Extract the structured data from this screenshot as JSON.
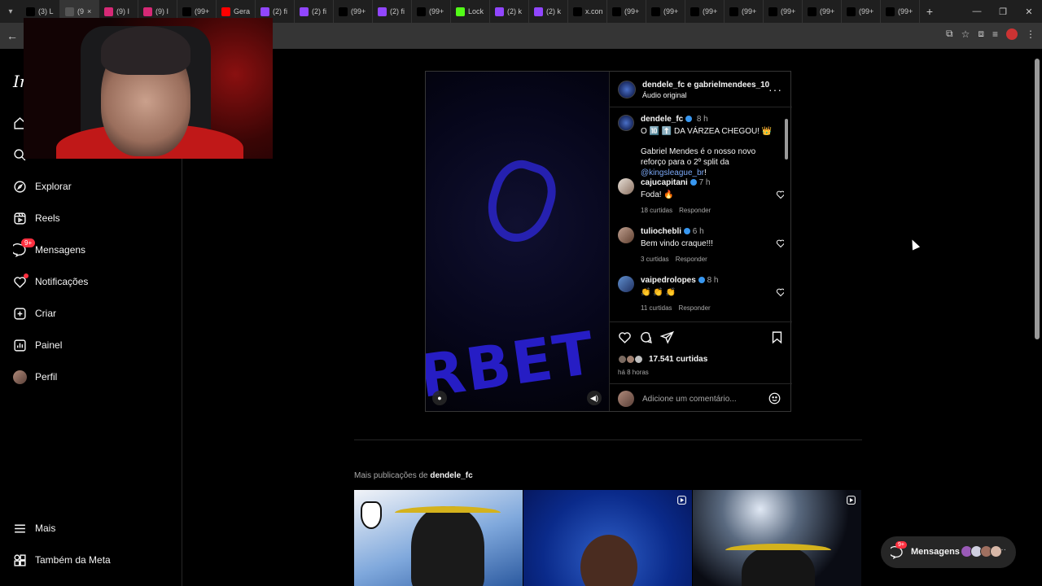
{
  "browser": {
    "tabs": [
      {
        "label": "(3) L",
        "favicon": "x-icon",
        "color": "#000000"
      },
      {
        "label": "(9",
        "favicon": "audio-icon",
        "color": "#555555",
        "active": true
      },
      {
        "label": "(9) I",
        "favicon": "instagram-icon",
        "color": "#d62976"
      },
      {
        "label": "(9) I",
        "favicon": "instagram-icon",
        "color": "#d62976"
      },
      {
        "label": "(99+",
        "favicon": "tiktok-icon",
        "color": "#000000"
      },
      {
        "label": "Gera",
        "favicon": "youtube-icon",
        "color": "#ff0000"
      },
      {
        "label": "(2) fi",
        "favicon": "twitch-icon",
        "color": "#9146ff"
      },
      {
        "label": "(2) fi",
        "favicon": "twitch-icon",
        "color": "#9146ff"
      },
      {
        "label": "(99+",
        "favicon": "tiktok-icon",
        "color": "#000000"
      },
      {
        "label": "(2) fi",
        "favicon": "twitch-icon",
        "color": "#9146ff"
      },
      {
        "label": "(99+",
        "favicon": "tiktok-icon",
        "color": "#000000"
      },
      {
        "label": "Lock",
        "favicon": "kick-icon",
        "color": "#53fc18"
      },
      {
        "label": "(2) k",
        "favicon": "twitch-icon",
        "color": "#9146ff"
      },
      {
        "label": "(2) k",
        "favicon": "twitch-icon",
        "color": "#9146ff"
      },
      {
        "label": "x.con",
        "favicon": "x-icon",
        "color": "#000000"
      },
      {
        "label": "(99+",
        "favicon": "tiktok-icon",
        "color": "#000000"
      },
      {
        "label": "(99+",
        "favicon": "tiktok-icon",
        "color": "#000000"
      },
      {
        "label": "(99+",
        "favicon": "tiktok-icon",
        "color": "#000000"
      },
      {
        "label": "(99+",
        "favicon": "tiktok-icon",
        "color": "#000000"
      },
      {
        "label": "(99+",
        "favicon": "tiktok-icon",
        "color": "#000000"
      },
      {
        "label": "(99+",
        "favicon": "tiktok-icon",
        "color": "#000000"
      },
      {
        "label": "(99+",
        "favicon": "tiktok-icon",
        "color": "#000000"
      },
      {
        "label": "(99+",
        "favicon": "tiktok-icon",
        "color": "#000000"
      }
    ]
  },
  "sidebar": {
    "logo": "In",
    "items": [
      {
        "label": "Explorar",
        "icon": "compass-icon"
      },
      {
        "label": "Reels",
        "icon": "reels-icon"
      },
      {
        "label": "Mensagens",
        "icon": "messenger-icon",
        "badge": "9+"
      },
      {
        "label": "Notificações",
        "icon": "heart-icon"
      },
      {
        "label": "Criar",
        "icon": "plus-square-icon"
      },
      {
        "label": "Painel",
        "icon": "chart-icon"
      },
      {
        "label": "Perfil",
        "icon": "avatar"
      }
    ],
    "bottom": [
      {
        "label": "Mais",
        "icon": "menu-icon"
      },
      {
        "label": "Também da Meta",
        "icon": "meta-grid-icon"
      }
    ]
  },
  "post": {
    "header": {
      "names": "dendele_fc e gabrielmendees_10",
      "audio": "Áudio original"
    },
    "caption": {
      "user": "dendele_fc",
      "time": "8 h",
      "line1": "O 🔟 ⬆️ DA VÁRZEA CHEGOU! 👑",
      "line2_prefix": "Gabriel Mendes é o nosso novo reforço para o 2º split da ",
      "line2_link": "@kingsleague_br",
      "line2_suffix": "!"
    },
    "comments": [
      {
        "user": "cajucapitani",
        "time": "7 h",
        "text": "Foda! 🔥",
        "likes": "18 curtidas",
        "reply": "Responder"
      },
      {
        "user": "tuliochebli",
        "time": "6 h",
        "text": "Bem vindo craque!!!",
        "likes": "3 curtidas",
        "reply": "Responder"
      },
      {
        "user": "vaipedrolopes",
        "time": "8 h",
        "text": "👏 👏 👏",
        "likes": "11 curtidas",
        "reply": "Responder"
      }
    ],
    "like_count": "17.541 curtidas",
    "posted_ago": "há 8 horas",
    "comment_placeholder": "Adicione um comentário..."
  },
  "more_posts": {
    "prefix": "Mais publicações de ",
    "user": "dendele_fc"
  },
  "messages_pill": {
    "label": "Mensagens",
    "badge": "9+"
  },
  "colors": {
    "background": "#000000",
    "accent_blue": "#3897f0",
    "badge_red": "#ff3040"
  }
}
